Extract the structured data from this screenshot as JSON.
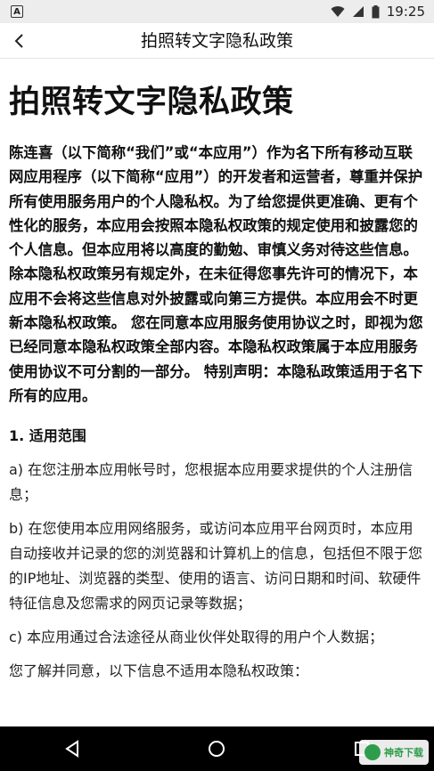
{
  "status_bar": {
    "time": "19:25",
    "notification_glyph": "A"
  },
  "app_bar": {
    "title": "拍照转文字隐私政策"
  },
  "content": {
    "heading": "拍照转文字隐私政策",
    "intro": "陈连喜（以下简称“我们”或“本应用”）作为名下所有移动互联网应用程序（以下简称“应用”）的开发者和运营者，尊重并保护所有使用服务用户的个人隐私权。为了给您提供更准确、更有个性化的服务，本应用会按照本隐私权政策的规定使用和披露您的个人信息。但本应用将以高度的勤勉、审慎义务对待这些信息。除本隐私权政策另有规定外，在未征得您事先许可的情况下，本应用不会将这些信息对外披露或向第三方提供。本应用会不时更新本隐私权政策。 您在同意本应用服务使用协议之时，即视为您已经同意本隐私权政策全部内容。本隐私权政策属于本应用服务使用协议不可分割的一部分。 特别声明：本隐私政策适用于名下所有的应用。",
    "section_title": "1. 适用范围",
    "paragraphs": [
      "a) 在您注册本应用帐号时，您根据本应用要求提供的个人注册信息；",
      "b) 在您使用本应用网络服务，或访问本应用平台网页时，本应用自动接收并记录的您的浏览器和计算机上的信息，包括但不限于您的IP地址、浏览器的类型、使用的语言、访问日期和时间、软硬件特征信息及您需求的网页记录等数据；",
      "c) 本应用通过合法途径从商业伙伴处取得的用户个人数据；",
      "您了解并同意，以下信息不适用本隐私权政策："
    ]
  },
  "watermark": {
    "text": "神奇下载"
  },
  "colors": {
    "status_bg": "#ededed",
    "nav_bg": "#000000",
    "text": "#111111",
    "watermark": "#2e9d4b"
  }
}
